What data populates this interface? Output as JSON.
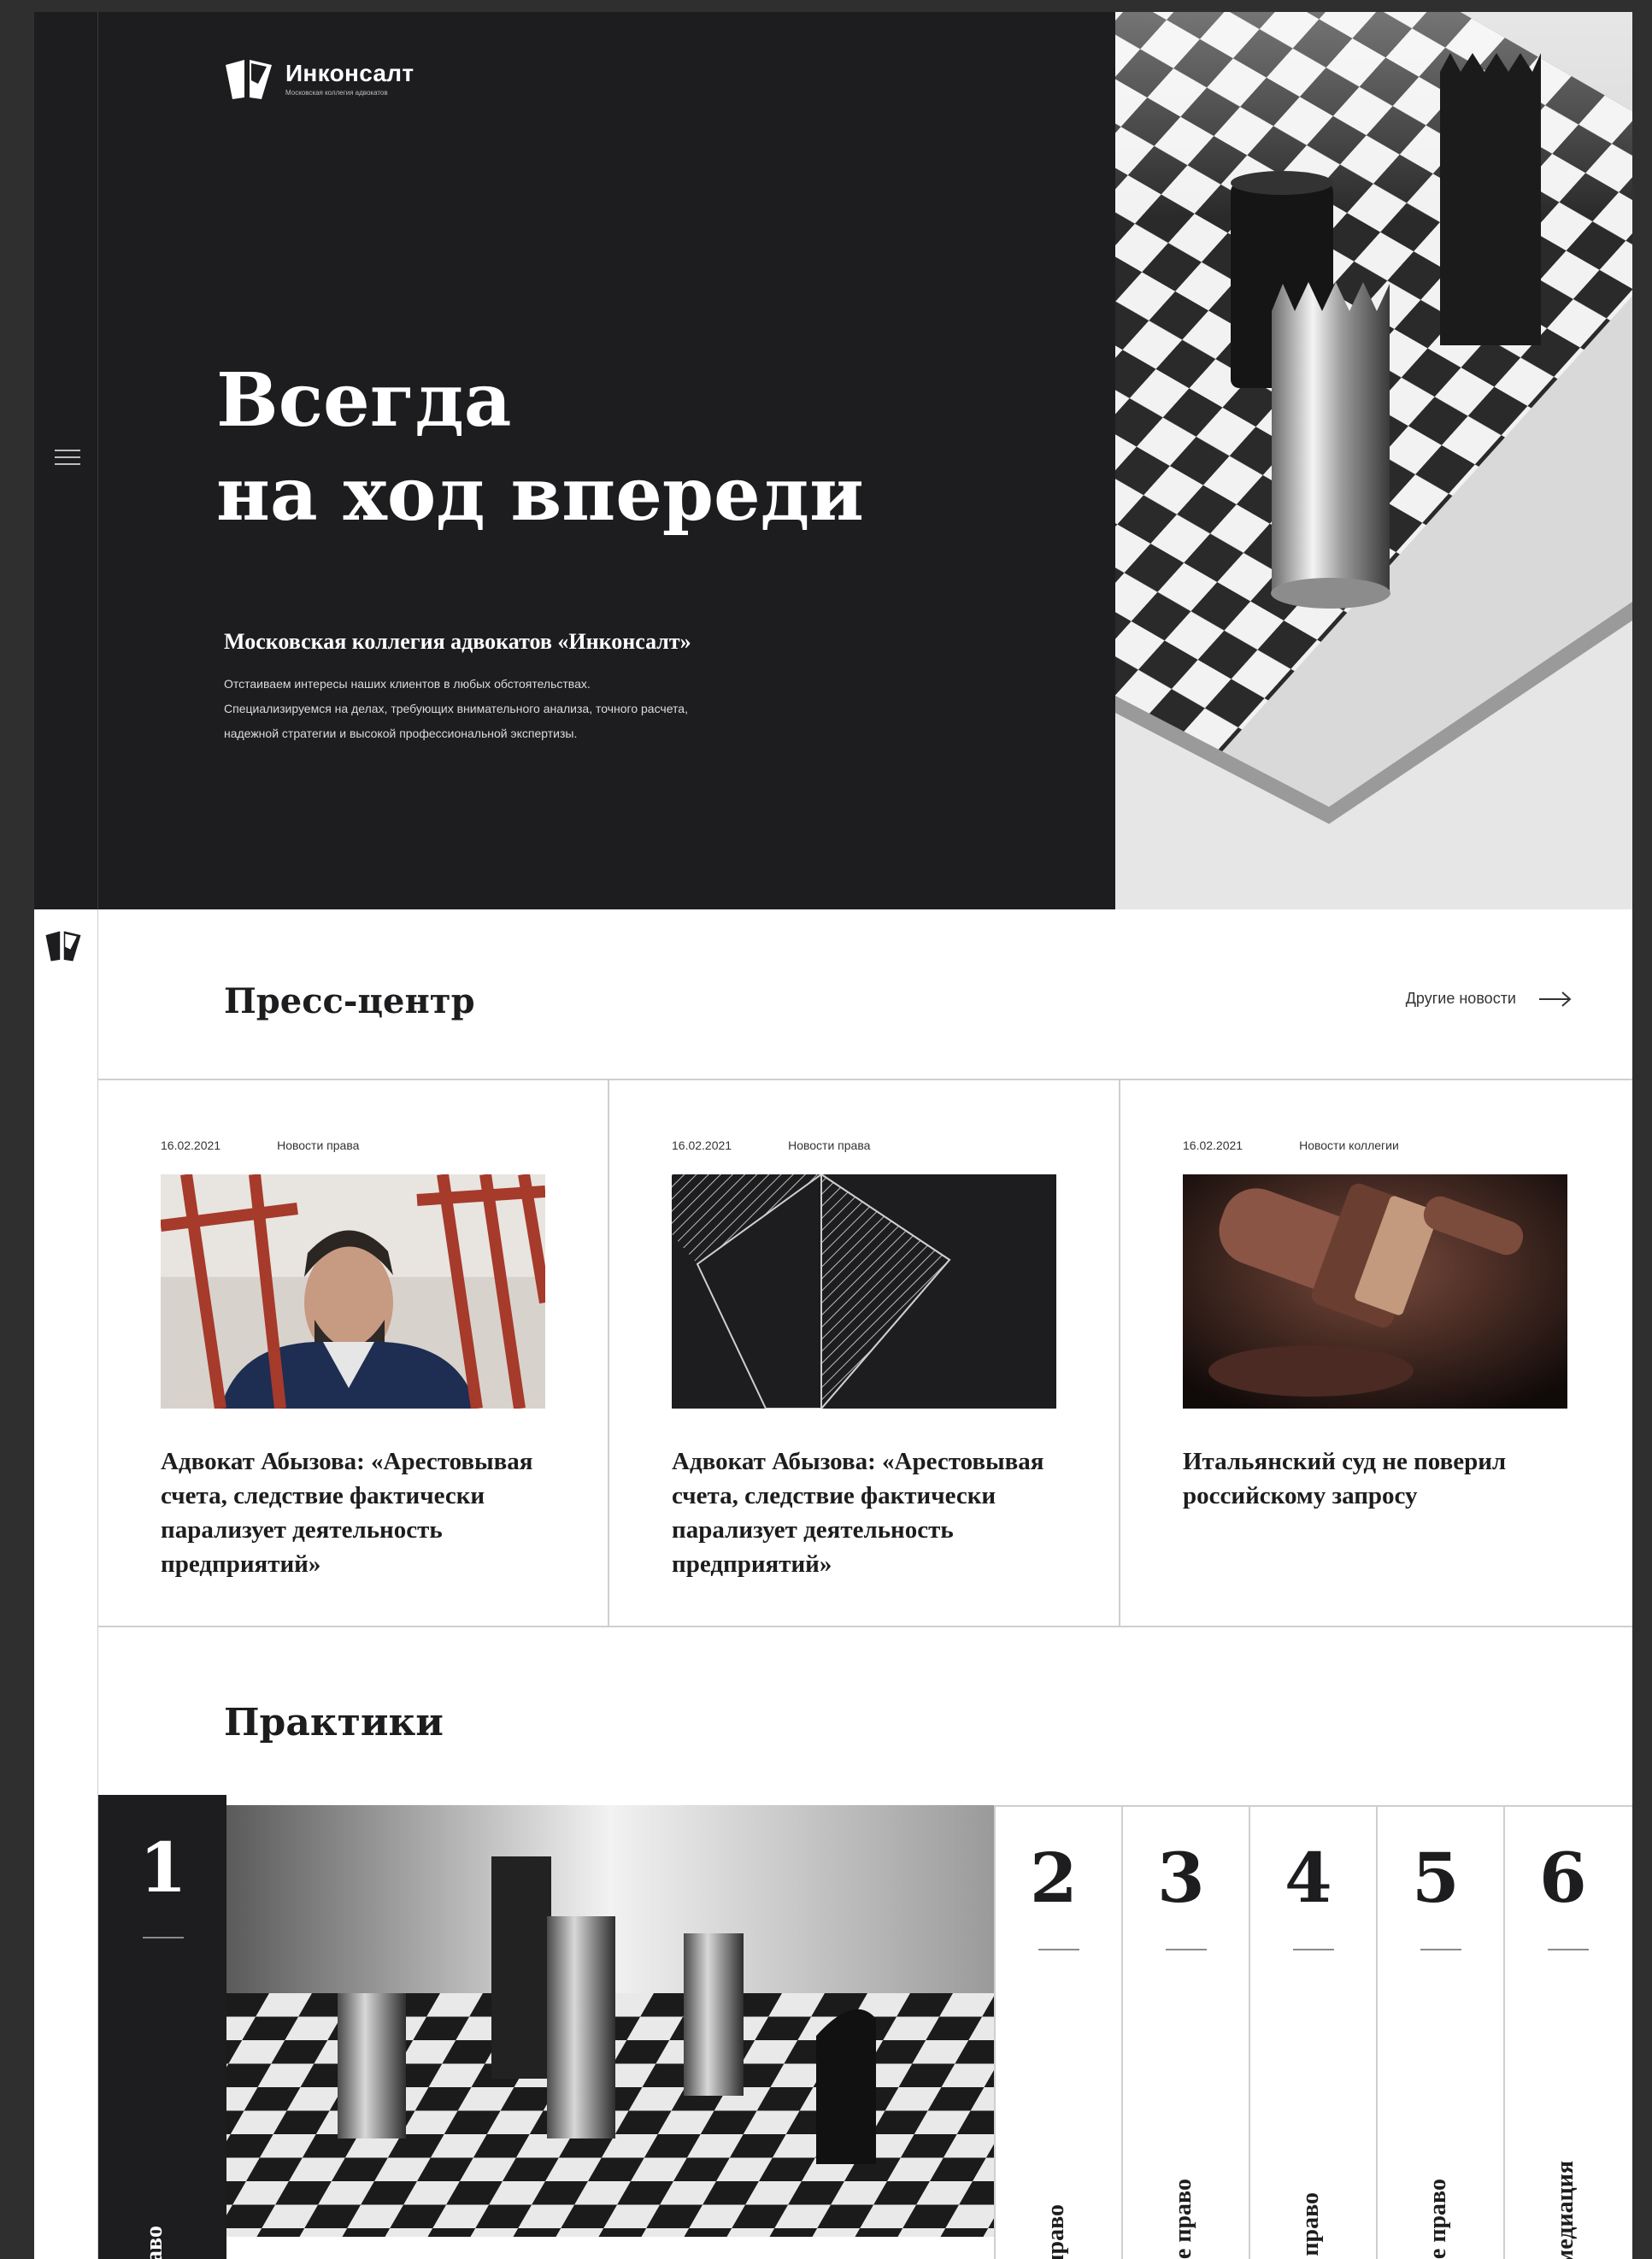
{
  "brand": {
    "name": "Инконсалт",
    "tagline": "Московская коллегия адвокатов"
  },
  "hero": {
    "title_line1": "Всегда",
    "title_line2": "на ход впереди",
    "subtitle": "Московская коллегия адвокатов «Инконсалт»",
    "description": [
      "Отстаиваем интересы наших клиентов в любых обстоятельствах.",
      "Специализируемся на делах, требующих внимательного анализа, точного расчета,",
      "надежной стратегии и высокой профессиональной экспертизы."
    ]
  },
  "press": {
    "title": "Пресс-центр",
    "more_label": "Другие новости",
    "items": [
      {
        "date": "16.02.2021",
        "category": "Новости права",
        "title": "Адвокат Абызова: «Арестовывая счета, следствие фактически парализует деятельность предприятий»",
        "image": "photo-man-behind-bars"
      },
      {
        "date": "16.02.2021",
        "category": "Новости права",
        "title": "Адвокат Абызова: «Арестовывая счета, следствие фактически парализует деятельность предприятий»",
        "image": "abstract-logo-graphic"
      },
      {
        "date": "16.02.2021",
        "category": "Новости коллегии",
        "title": "Итальянский суд не поверил российскому запросу",
        "image": "photo-judge-gavel"
      }
    ]
  },
  "practices": {
    "title": "Практики",
    "items": [
      {
        "number": "1",
        "label": "аво"
      },
      {
        "number": "2",
        "label": "е право"
      },
      {
        "number": "3",
        "label": "ное право"
      },
      {
        "number": "4",
        "label": "ое право"
      },
      {
        "number": "5",
        "label": "ное право"
      },
      {
        "number": "6",
        "label": "я медиация"
      }
    ]
  },
  "colors": {
    "dark": "#1d1d1f",
    "outer_background": "#2f2f2f",
    "border": "#cfcfcf",
    "accent_bars": "#a63a2b"
  },
  "icons": {
    "menu": "hamburger-icon",
    "more": "arrow-right-icon",
    "logo": "logo-mark-icon"
  }
}
